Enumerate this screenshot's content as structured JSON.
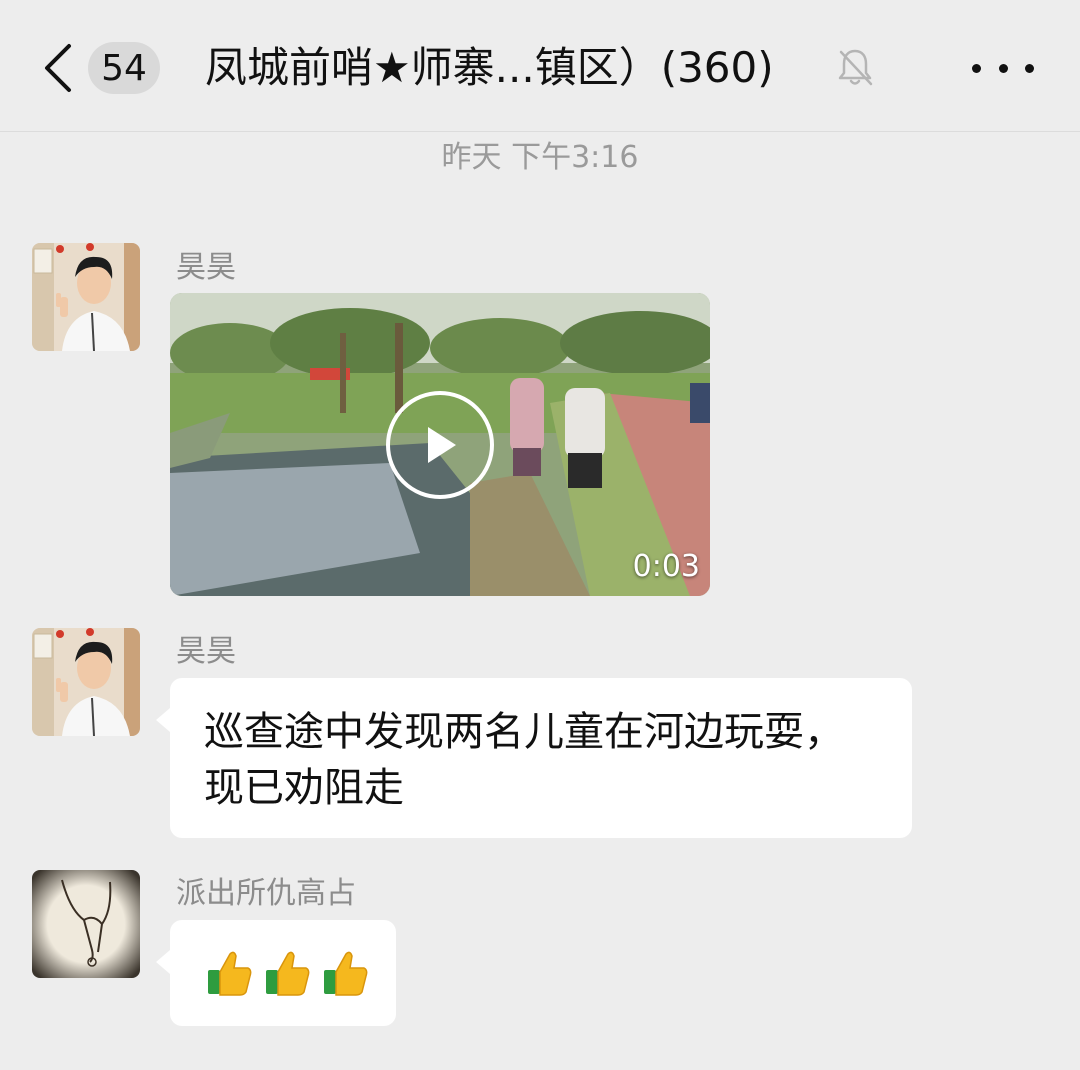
{
  "header": {
    "back_icon": "chevron-left-icon",
    "unread_count": "54",
    "title": "凤城前哨★师寨...镇区）(360)",
    "mute_icon": "bell-off-icon",
    "more_icon": "more-dots-icon"
  },
  "timestamp": "昨天 下午3:16",
  "messages": [
    {
      "sender": "昊昊",
      "type": "video",
      "duration": "0:03"
    },
    {
      "sender": "昊昊",
      "type": "text",
      "text_line1": "巡查途中发现两名儿童在河边玩耍，",
      "text_line2": "现已劝阻走"
    },
    {
      "sender": "派出所仇高占",
      "type": "emoji",
      "emoji": [
        "👍",
        "👍",
        "👍"
      ]
    }
  ],
  "colors": {
    "background": "#ededed",
    "bubble": "#ffffff",
    "meta_text": "#9a9a9a"
  }
}
